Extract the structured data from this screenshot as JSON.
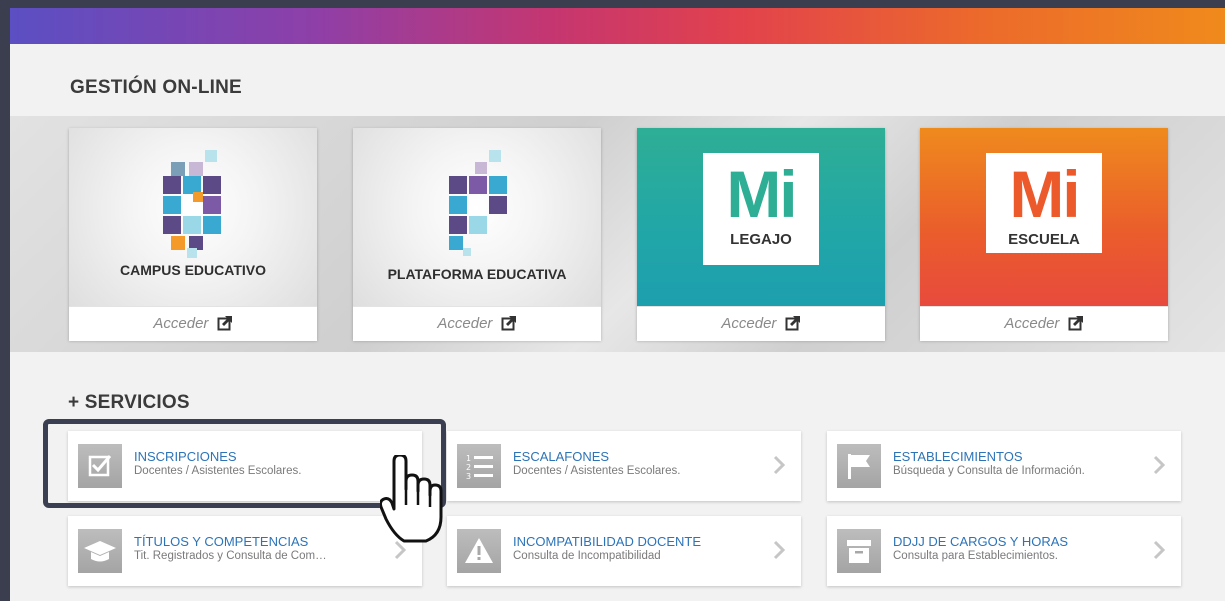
{
  "sections": {
    "gestion_title": "GESTIÓN ON-LINE",
    "servicios_title": "+ SERVICIOS"
  },
  "cards": [
    {
      "label": "CAMPUS EDUCATIVO",
      "access": "Acceder",
      "icon": "campus-logo-icon"
    },
    {
      "label": "PLATAFORMA EDUCATIVA",
      "access": "Acceder",
      "icon": "plataforma-logo-icon"
    },
    {
      "label_mi": "Mi",
      "label_sub": "LEGAJO",
      "access": "Acceder",
      "color": "#2eae95"
    },
    {
      "label_mi": "Mi",
      "label_sub": "ESCUELA",
      "access": "Acceder",
      "color": "#ec5a2c"
    }
  ],
  "services": [
    {
      "title": "INSCRIPCIONES",
      "desc": "Docentes / Asistentes Escolares.",
      "icon": "checkbox-icon"
    },
    {
      "title": "ESCALAFONES",
      "desc": "Docentes / Asistentes Escolares.",
      "icon": "numbered-list-icon"
    },
    {
      "title": "ESTABLECIMIENTOS",
      "desc": "Búsqueda y Consulta de Información.",
      "icon": "flag-icon"
    },
    {
      "title": "TÍTULOS Y COMPETENCIAS",
      "desc": "Tit. Registrados y Consulta de Com…",
      "icon": "graduation-cap-icon"
    },
    {
      "title": "INCOMPATIBILIDAD DOCENTE",
      "desc": "Consulta de Incompatibilidad",
      "icon": "warning-icon"
    },
    {
      "title": "DDJJ DE CARGOS Y HORAS",
      "desc": "Consulta para Establecimientos.",
      "icon": "archive-box-icon"
    }
  ],
  "colors": {
    "link_blue": "#2c74b8",
    "teal": "#2eae95",
    "orange": "#ec5a2c",
    "highlight_border": "#3b3f52"
  }
}
